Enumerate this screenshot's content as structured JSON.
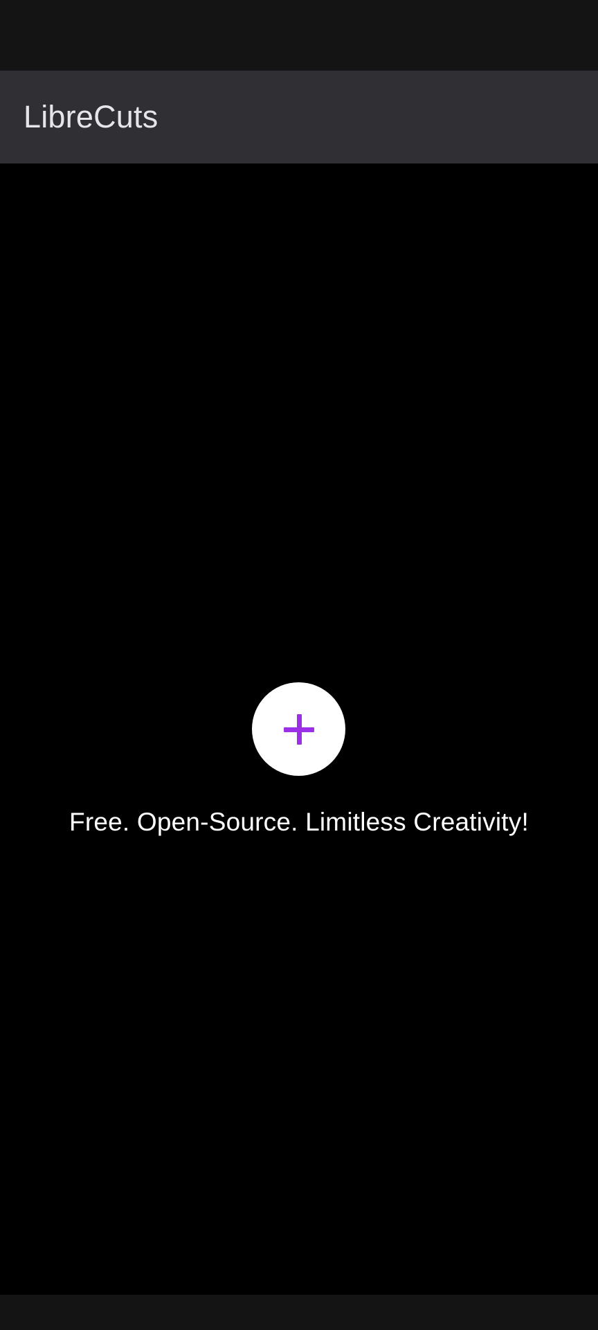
{
  "app_bar": {
    "title": "LibreCuts"
  },
  "main": {
    "add_button_icon": "plus-icon",
    "tagline": "Free. Open-Source. Limitless Creativity!"
  },
  "colors": {
    "accent": "#9b30e8",
    "app_bar_bg": "#303034",
    "system_bar_bg": "#141415",
    "background": "#000000"
  }
}
